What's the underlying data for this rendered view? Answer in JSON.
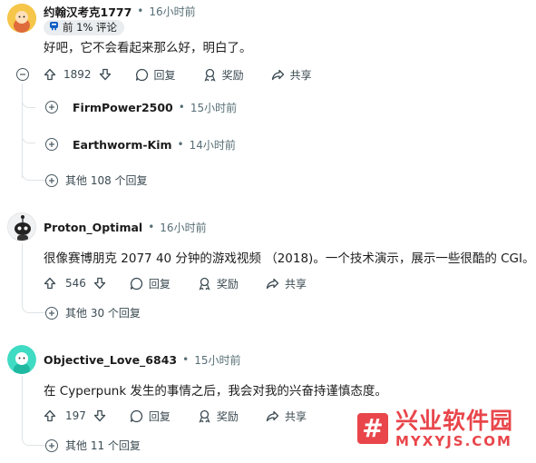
{
  "comments": [
    {
      "username": "约翰汉考克1777",
      "time": "16小时前",
      "flair": "前 1% 评论",
      "body": "好吧，它不会看起来那么好，明白了。",
      "votes": "1892",
      "reply_label": "回复",
      "award_label": "奖励",
      "share_label": "共享",
      "replies": [
        {
          "username": "FirmPower2500",
          "time": "15小时前"
        },
        {
          "username": "Earthworm-Kim",
          "time": "14小时前"
        }
      ],
      "more": "其他 108 个回复"
    },
    {
      "username": "Proton_Optimal",
      "time": "16小时前",
      "body": "很像赛博朋克 2077 40 分钟的游戏视频 （2018)。一个技术演示，展示一些很酷的 CGI。",
      "votes": "546",
      "reply_label": "回复",
      "award_label": "奖励",
      "share_label": "共享",
      "more": "其他 30 个回复"
    },
    {
      "username": "Objective_Love_6843",
      "time": "15小时前",
      "body": "在 Cyperpunk 发生的事情之后，我会对我的兴奋持谨慎态度。",
      "votes": "197",
      "reply_label": "回复",
      "award_label": "奖励",
      "share_label": "共享",
      "more": "其他 11 个回复"
    }
  ],
  "separator": "•",
  "watermark": {
    "title": "兴业软件园",
    "subtitle": "MYXYJS.COM",
    "symbol": "#"
  },
  "colors": {
    "accent_watermark": "#e8464b",
    "avatar1": "#f5c542",
    "avatar3": "#3dd8c1"
  }
}
